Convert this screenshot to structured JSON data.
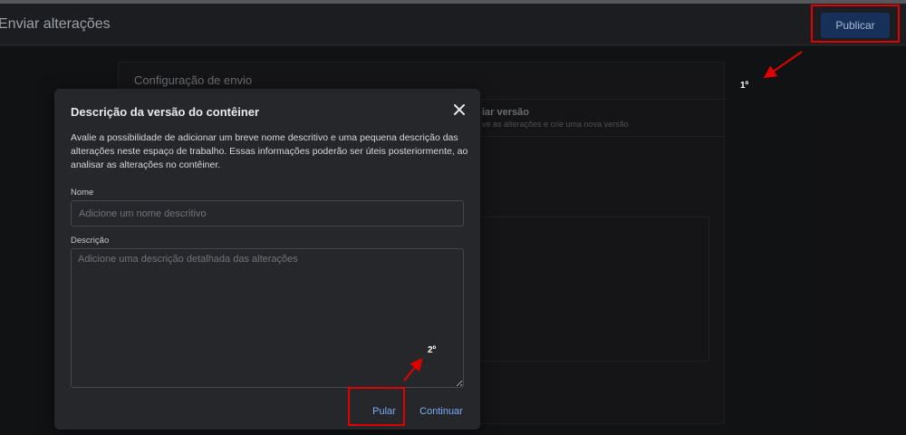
{
  "header": {
    "title": "Enviar alterações",
    "publish_label": "Publicar"
  },
  "background": {
    "card_title": "Configuração de envio",
    "option_title": "iar versão",
    "option_subtitle": "ve as alterações e crie uma nova versão"
  },
  "dialog": {
    "title": "Descrição da versão do contêiner",
    "description": "Avalie a possibilidade de adicionar um breve nome descritivo e uma pequena descrição das alterações neste espaço de trabalho. Essas informações poderão ser úteis posteriormente, ao analisar as alterações no contêiner.",
    "name_label": "Nome",
    "name_placeholder": "Adicione um nome descritivo",
    "description_label": "Descrição",
    "description_placeholder": "Adicione uma descrição detalhada das alterações",
    "skip_label": "Pular",
    "continue_label": "Continuar",
    "close_icon": "close-icon"
  },
  "annotations": {
    "step1": "1º",
    "step2": "2º",
    "highlight_color": "#e00000"
  },
  "colors": {
    "background": "#1a1b1e",
    "dialog": "#26272b",
    "accent": "#7cacf8",
    "publish_button": "#17305a"
  }
}
